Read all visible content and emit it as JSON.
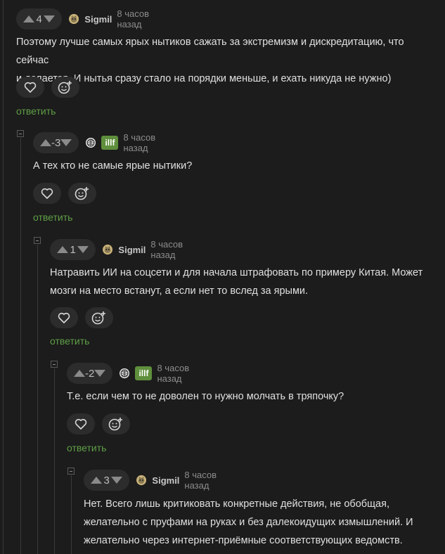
{
  "colors": {
    "background": "#1c1c1c",
    "accent_green": "#5f9f46",
    "badge_green": "#5f8f3c"
  },
  "comments": [
    {
      "score": "4",
      "author": "Sigmil",
      "badge": "",
      "time": "8 часов назад",
      "lines": [
        "Поэтому лучше самых ярых нытиков сажать за экстремизм и дискредитацию, что сейчас",
        "и делается. И нытья сразу стало на порядки меньше, и ехать никуда не нужно)"
      ],
      "reply_label": "ответить",
      "avatar_icon": "cat-avatar-icon"
    },
    {
      "score": "-3",
      "author": "",
      "badge": "illf",
      "time": "8 часов назад",
      "lines": [
        "А тех кто не самые ярые нытики?"
      ],
      "reply_label": "ответить",
      "avatar_icon": "globe-avatar-icon"
    },
    {
      "score": "1",
      "author": "Sigmil",
      "badge": "",
      "time": "8 часов назад",
      "lines": [
        "Натравить ИИ на соцсети и для начала штрафовать по примеру Китая. Может",
        "мозги на место встанут, а если нет то вслед за ярыми."
      ],
      "reply_label": "ответить",
      "avatar_icon": "cat-avatar-icon"
    },
    {
      "score": "-2",
      "author": "",
      "badge": "illf",
      "time": "8 часов назад",
      "lines": [
        "Т.е. если чем то не доволен то нужно молчать в тряпочку?"
      ],
      "reply_label": "ответить",
      "avatar_icon": "globe-avatar-icon"
    },
    {
      "score": "3",
      "author": "Sigmil",
      "badge": "",
      "time": "8 часов назад",
      "lines": [
        "Нет. Всего лишь критиковать конкретные действия, не обобщая,",
        "желательно с пруфами на руках и без далекоидущих измышлений. И",
        "желательно через интернет-приёмные соответствующих ведомств."
      ],
      "reply_label": "",
      "avatar_icon": "cat-avatar-icon"
    }
  ]
}
